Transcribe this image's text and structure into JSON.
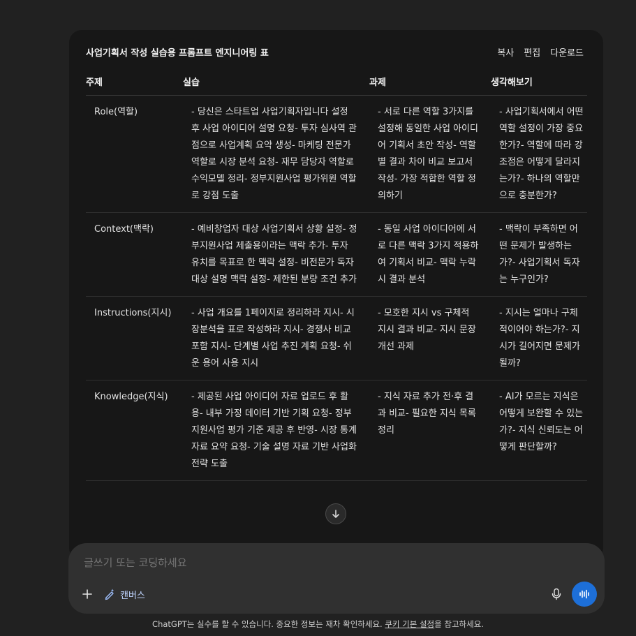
{
  "card": {
    "title": "사업기획서 작성 실습용 프롬프트 엔지니어링 표",
    "actions": [
      "복사",
      "편집",
      "다운로드"
    ]
  },
  "table": {
    "headers": [
      "주제",
      "실습",
      "과제",
      "생각해보기"
    ],
    "rows": [
      {
        "topic": "Role(역할)",
        "practice": "- 당신은 스타트업 사업기획자입니다 설정 후 사업 아이디어 설명 요청- 투자 심사역 관점으로 사업계획 요약 생성- 마케팅 전문가 역할로 시장 분석 요청- 재무 담당자 역할로 수익모델 정리- 정부지원사업 평가위원 역할로 강점 도출",
        "task": "- 서로 다른 역할 3가지를 설정해 동일한 사업 아이디어 기획서 초안 작성- 역할별 결과 차이 비교 보고서 작성- 가장 적합한 역할 정의하기",
        "think": "- 사업기획서에서 어떤 역할 설정이 가장 중요한가?- 역할에 따라 강조점은 어떻게 달라지는가?- 하나의 역할만으로 충분한가?"
      },
      {
        "topic": "Context(맥락)",
        "practice": "- 예비창업자 대상 사업기획서 상황 설정- 정부지원사업 제출용이라는 맥락 추가- 투자 유치를 목표로 한 맥락 설정- 비전문가 독자 대상 설명 맥락 설정- 제한된 분량 조건 추가",
        "task": "- 동일 사업 아이디어에 서로 다른 맥락 3가지 적용하여 기획서 비교- 맥락 누락 시 결과 분석",
        "think": "- 맥락이 부족하면 어떤 문제가 발생하는가?- 사업기획서 독자는 누구인가?"
      },
      {
        "topic": "Instructions(지시)",
        "practice": "- 사업 개요를 1페이지로 정리하라 지시- 시장분석을 표로 작성하라 지시- 경쟁사 비교 포함 지시- 단계별 사업 추진 계획 요청- 쉬운 용어 사용 지시",
        "task": "- 모호한 지시 vs 구체적 지시 결과 비교- 지시 문장 개선 과제",
        "think": "- 지시는 얼마나 구체적이어야 하는가?- 지시가 길어지면 문제가 될까?"
      },
      {
        "topic": "Knowledge(지식)",
        "practice": "- 제공된 사업 아이디어 자료 업로드 후 활용- 내부 가정 데이터 기반 기획 요청- 정부지원사업 평가 기준 제공 후 반영- 시장 통계 자료 요약 요청- 기술 설명 자료 기반 사업화 전략 도출",
        "task": "- 지식 자료 추가 전·후 결과 비교- 필요한 지식 목록 정리",
        "think": "- AI가 모르는 지식은 어떻게 보완할 수 있는가?- 지식 신뢰도는 어떻게 판단할까?"
      }
    ]
  },
  "composer": {
    "placeholder": "글쓰기 또는 코딩하세요",
    "canvas_label": "캔버스"
  },
  "footer": {
    "note_before": "ChatGPT는 실수를 할 수 있습니다. 중요한 정보는 재차 확인하세요. ",
    "link": "쿠키 기본 설정",
    "note_after": "을 참고하세요."
  },
  "colors": {
    "background": "#212121",
    "card": "#171717",
    "composer": "#303030",
    "accent": "#1d6fd8"
  }
}
